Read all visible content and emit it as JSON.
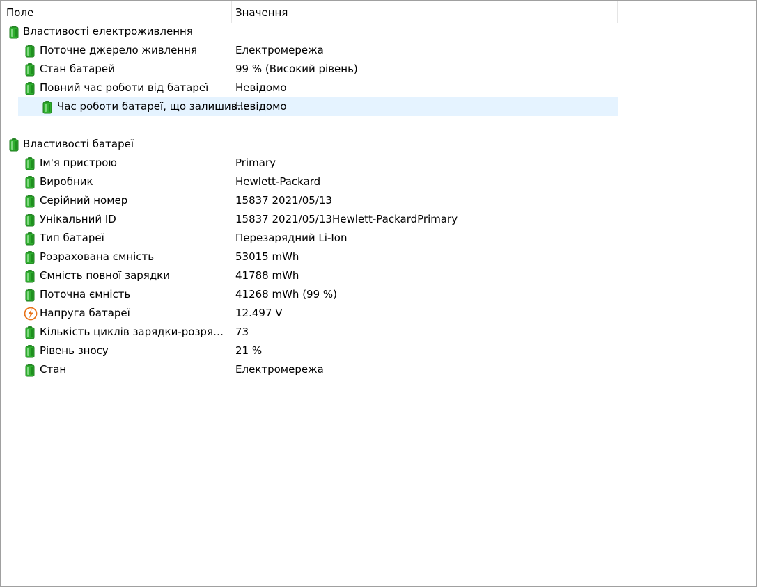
{
  "columns": {
    "field": "Поле",
    "value": "Значення"
  },
  "group_power": {
    "title": "Властивості електроживлення",
    "rows": [
      {
        "field": "Поточне джерело живлення",
        "value": "Електромережа",
        "icon": "battery-icon"
      },
      {
        "field": "Стан батарей",
        "value": "99 % (Високий рівень)",
        "icon": "battery-icon"
      },
      {
        "field": "Повний час роботи від батареї",
        "value": "Невідомо",
        "icon": "battery-icon"
      },
      {
        "field": "Час роботи батареї, що залишив...",
        "value": "Невідомо",
        "icon": "battery-icon",
        "selected": true
      }
    ]
  },
  "group_battery": {
    "title": "Властивості батареї",
    "rows": [
      {
        "field": "Ім'я пристрою",
        "value": "Primary",
        "icon": "battery-icon"
      },
      {
        "field": "Виробник",
        "value": "Hewlett-Packard",
        "icon": "battery-icon"
      },
      {
        "field": "Серійний номер",
        "value": "15837 2021/05/13",
        "icon": "battery-icon"
      },
      {
        "field": "Унікальний ID",
        "value": "15837 2021/05/13Hewlett-PackardPrimary",
        "icon": "battery-icon"
      },
      {
        "field": "Тип батареї",
        "value": "Перезарядний Li-Ion",
        "icon": "battery-icon"
      },
      {
        "field": "Розрахована ємність",
        "value": "53015 mWh",
        "icon": "battery-icon"
      },
      {
        "field": "Ємність повної зарядки",
        "value": "41788 mWh",
        "icon": "battery-icon"
      },
      {
        "field": "Поточна ємність",
        "value": "41268 mWh  (99 %)",
        "icon": "battery-icon"
      },
      {
        "field": "Напруга батареї",
        "value": "12.497 V",
        "icon": "voltage-icon"
      },
      {
        "field": "Кількість циклів зарядки-розрядки",
        "value": "73",
        "icon": "battery-icon"
      },
      {
        "field": "Рівень зносу",
        "value": "21 %",
        "icon": "battery-icon"
      },
      {
        "field": "Стан",
        "value": "Електромережа",
        "icon": "battery-icon"
      }
    ]
  },
  "colors": {
    "battery_green": "#2fae2f",
    "selection": "#e5f3ff",
    "voltage_orange": "#e8731a"
  }
}
